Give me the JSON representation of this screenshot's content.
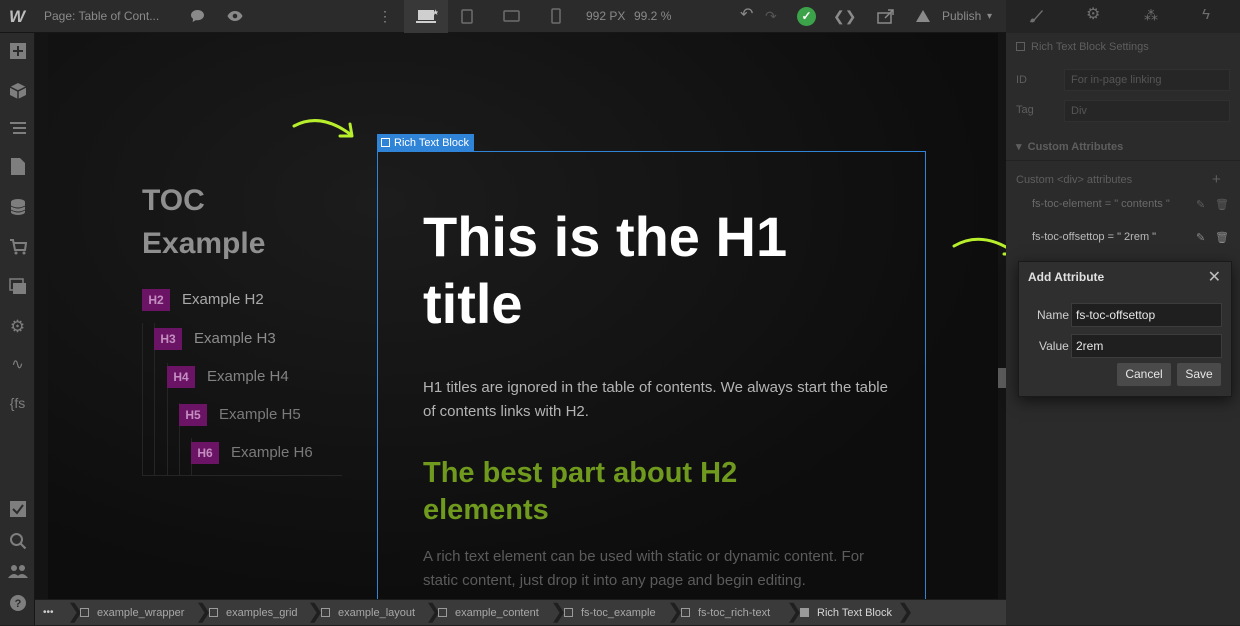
{
  "topbar": {
    "page_label": "Page: Table of Cont...",
    "canvas_width": "992 PX",
    "zoom": "99.2 %",
    "publish_label": "Publish",
    "icons": [
      "webflow-logo-icon",
      "comment-icon",
      "eye-icon",
      "more-vertical-icon",
      "desktop-icon",
      "tablet-icon",
      "tablet-landscape-icon",
      "phone-icon",
      "undo-icon",
      "redo-icon",
      "check-icon",
      "code-icon",
      "export-icon",
      "publish-icon",
      "chevron-down-icon",
      "brush-icon",
      "gear-icon",
      "interactions-icon",
      "lightning-icon"
    ]
  },
  "leftbar": {
    "icons": [
      "add-icon",
      "cube-icon",
      "layers-icon",
      "pages-icon",
      "cms-icon",
      "ecommerce-icon",
      "assets-icon",
      "settings-icon",
      "audit-icon",
      "finsweet-icon",
      "checklist-icon",
      "search-icon",
      "users-icon",
      "help-icon"
    ],
    "finsweet_label": "{fs"
  },
  "canvas": {
    "toc_title_line1": "TOC",
    "toc_title_line2": "Example",
    "toc_items": [
      {
        "tag": "H2",
        "label": "Example H2"
      },
      {
        "tag": "H3",
        "label": "Example H3"
      },
      {
        "tag": "H4",
        "label": "Example H4"
      },
      {
        "tag": "H5",
        "label": "Example H5"
      },
      {
        "tag": "H6",
        "label": "Example H6"
      }
    ],
    "selection_label": "Rich Text Block",
    "h1_line1": "This is the H1",
    "h1_line2": "title",
    "paragraph1": "H1 titles are ignored in the table of contents. We always start the table of contents links with H2.",
    "h2_line1": "The best part about H2",
    "h2_line2": "elements",
    "paragraph2": "A rich text element can be used with static or dynamic content. For static content, just drop it into any page and begin editing."
  },
  "breadcrumb": {
    "more_label": "•••",
    "items": [
      "example_wrapper",
      "examples_grid",
      "example_layout",
      "example_content",
      "fs-toc_example",
      "fs-toc_rich-text",
      "Rich Text Block"
    ]
  },
  "rightpanel": {
    "section_title": "Rich Text Block Settings",
    "id_label": "ID",
    "id_placeholder": "For in-page linking",
    "tag_label": "Tag",
    "tag_value": "Div",
    "custom_attributes_title": "Custom Attributes",
    "custom_div_label": "Custom <div> attributes",
    "attributes": [
      {
        "text": "fs-toc-element = \" contents \""
      },
      {
        "text": "fs-toc-offsettop = \" 2rem \""
      }
    ]
  },
  "dialog": {
    "title": "Add Attribute",
    "name_label": "Name",
    "name_value": "fs-toc-offsettop",
    "value_label": "Value",
    "value_value": "2rem",
    "cancel_label": "Cancel",
    "save_label": "Save"
  },
  "colors": {
    "selection_blue": "#2f84d8",
    "heading_tag_purple": "#6b1466",
    "h2_green": "#6f9a1e",
    "arrow_green": "#b8ef2c",
    "success_green": "#3ca34a"
  }
}
